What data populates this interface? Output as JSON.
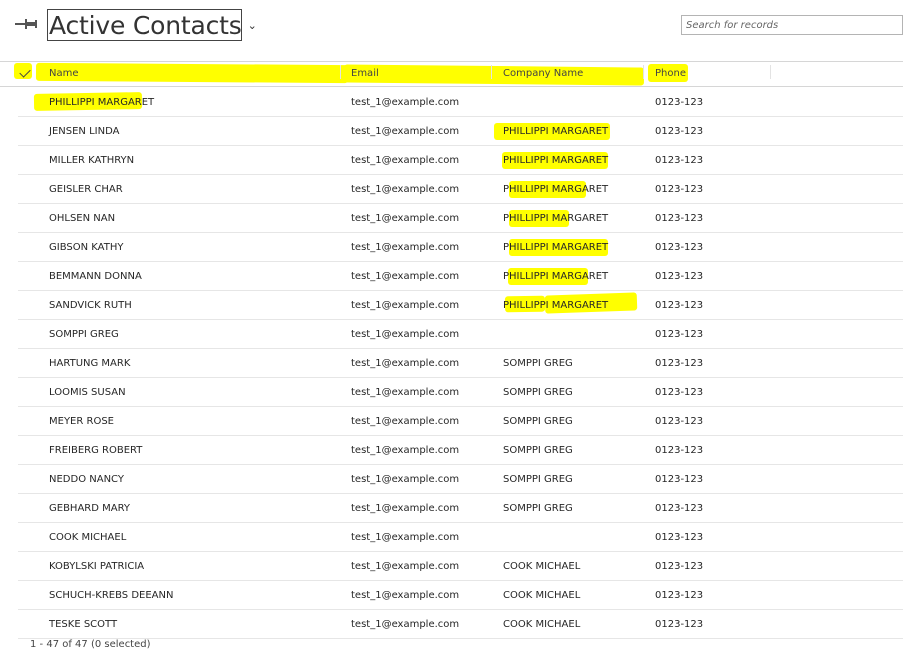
{
  "header": {
    "title": "Active Contacts",
    "search_placeholder": "Search for records"
  },
  "columns": {
    "name": "Name",
    "email": "Email",
    "company": "Company Name",
    "phone": "Phone"
  },
  "rows": [
    {
      "name": "PHILLIPPI MARGARET",
      "email": "test_1@example.com",
      "company": "",
      "phone": "0123-123"
    },
    {
      "name": "JENSEN LINDA",
      "email": "test_1@example.com",
      "company": "PHILLIPPI MARGARET",
      "phone": "0123-123"
    },
    {
      "name": "MILLER KATHRYN",
      "email": "test_1@example.com",
      "company": "PHILLIPPI MARGARET",
      "phone": "0123-123"
    },
    {
      "name": "GEISLER CHAR",
      "email": "test_1@example.com",
      "company": "PHILLIPPI MARGARET",
      "phone": "0123-123"
    },
    {
      "name": "OHLSEN NAN",
      "email": "test_1@example.com",
      "company": "PHILLIPPI MARGARET",
      "phone": "0123-123"
    },
    {
      "name": "GIBSON KATHY",
      "email": "test_1@example.com",
      "company": "PHILLIPPI MARGARET",
      "phone": "0123-123"
    },
    {
      "name": "BEMMANN DONNA",
      "email": "test_1@example.com",
      "company": "PHILLIPPI MARGARET",
      "phone": "0123-123"
    },
    {
      "name": "SANDVICK RUTH",
      "email": "test_1@example.com",
      "company": "PHILLIPPI MARGARET",
      "phone": "0123-123"
    },
    {
      "name": "SOMPPI GREG",
      "email": "test_1@example.com",
      "company": "",
      "phone": "0123-123"
    },
    {
      "name": "HARTUNG MARK",
      "email": "test_1@example.com",
      "company": "SOMPPI GREG",
      "phone": "0123-123"
    },
    {
      "name": "LOOMIS SUSAN",
      "email": "test_1@example.com",
      "company": "SOMPPI GREG",
      "phone": "0123-123"
    },
    {
      "name": "MEYER ROSE",
      "email": "test_1@example.com",
      "company": "SOMPPI GREG",
      "phone": "0123-123"
    },
    {
      "name": "FREIBERG ROBERT",
      "email": "test_1@example.com",
      "company": "SOMPPI GREG",
      "phone": "0123-123"
    },
    {
      "name": "NEDDO NANCY",
      "email": "test_1@example.com",
      "company": "SOMPPI GREG",
      "phone": "0123-123"
    },
    {
      "name": "GEBHARD MARY",
      "email": "test_1@example.com",
      "company": "SOMPPI GREG",
      "phone": "0123-123"
    },
    {
      "name": "COOK MICHAEL",
      "email": "test_1@example.com",
      "company": "",
      "phone": "0123-123"
    },
    {
      "name": "KOBYLSKI PATRICIA",
      "email": "test_1@example.com",
      "company": "COOK MICHAEL",
      "phone": "0123-123"
    },
    {
      "name": "SCHUCH-KREBS DEEANN",
      "email": "test_1@example.com",
      "company": "COOK MICHAEL",
      "phone": "0123-123"
    },
    {
      "name": "TESKE SCOTT",
      "email": "test_1@example.com",
      "company": "COOK MICHAEL",
      "phone": "0123-123"
    }
  ],
  "footer": {
    "status": "1 - 47 of 47 (0 selected)"
  },
  "colors": {
    "highlight": "#ffff00",
    "border": "#d6d6d6"
  }
}
